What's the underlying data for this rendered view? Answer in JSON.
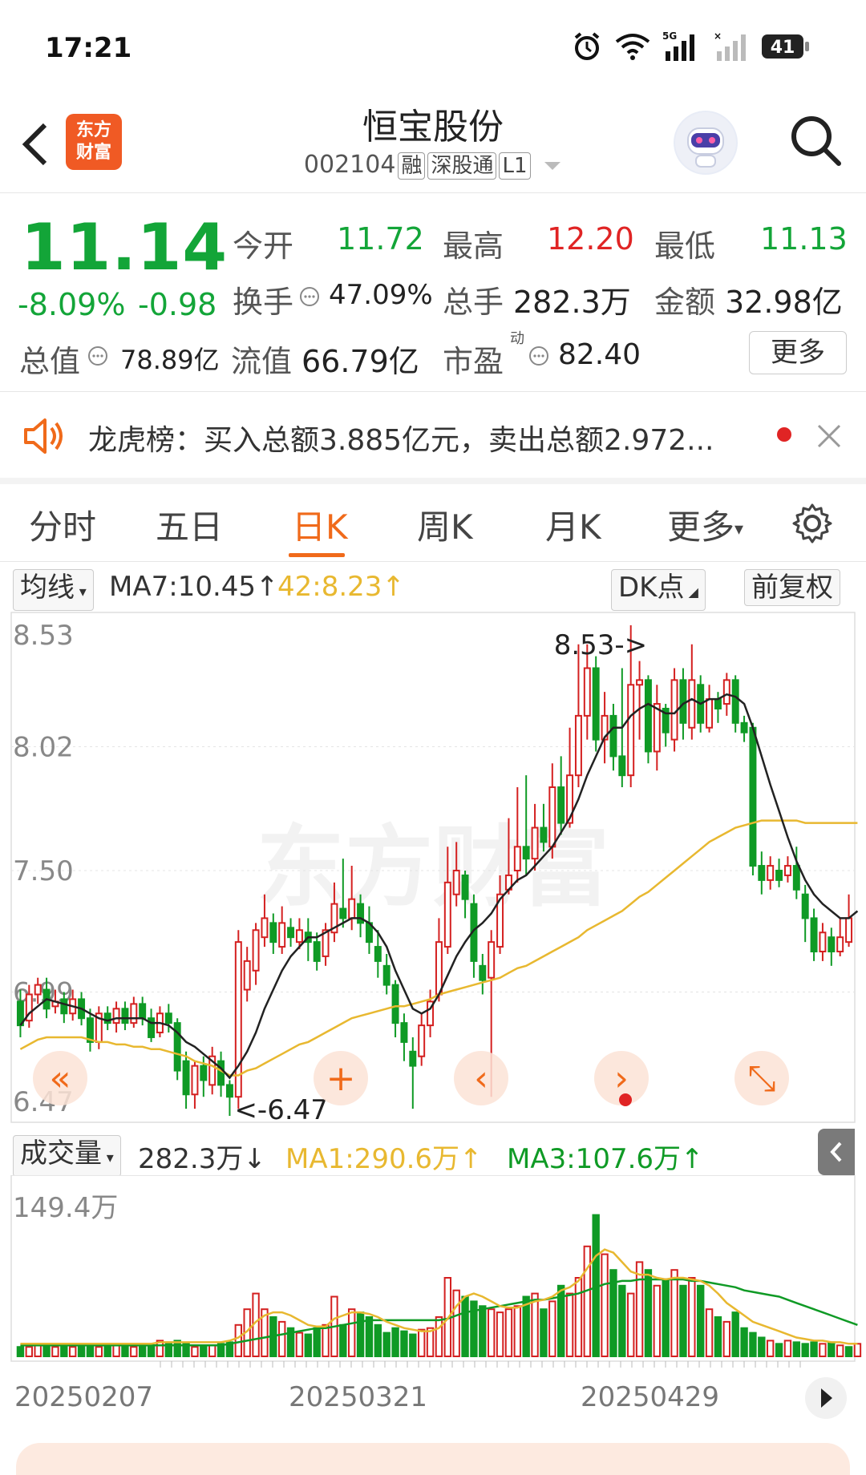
{
  "status": {
    "time": "17:21",
    "battery": "41",
    "network": "5G"
  },
  "header": {
    "logo_line1": "东方",
    "logo_line2": "财富",
    "title": "恒宝股份",
    "code": "002104",
    "tags": [
      "融",
      "深股通",
      "L1"
    ]
  },
  "quote": {
    "price": "11.14",
    "change_pct": "-8.09%",
    "change": "-0.98",
    "open_label": "今开",
    "open": "11.72",
    "high_label": "最高",
    "high": "12.20",
    "low_label": "最低",
    "low": "11.13",
    "turnover_label": "换手",
    "turnover": "47.09%",
    "volume_label": "总手",
    "volume": "282.3万",
    "amount_label": "金额",
    "amount": "32.98亿",
    "total_cap_label": "总值",
    "total_cap": "78.89亿",
    "float_cap_label": "流值",
    "float_cap": "66.79亿",
    "pe_label": "市盈",
    "pe_sup": "动",
    "pe": "82.40",
    "more": "更多"
  },
  "notice": {
    "text": "龙虎榜：买入总额3.885亿元，卖出总额2.972..."
  },
  "tabs": [
    "分时",
    "五日",
    "日K",
    "周K",
    "月K",
    "更多"
  ],
  "active_tab": "日K",
  "chart_toolbar": {
    "indicator": "均线",
    "ma7": "MA7:10.45↑",
    "ma42": "42:8.23↑",
    "dk": "DK点",
    "adjust": "前复权"
  },
  "volume_toolbar": {
    "indicator": "成交量",
    "vol": "282.3万↓",
    "ma1": "MA1:290.6万↑",
    "ma3": "MA3:107.6万↑"
  },
  "colors": {
    "up": "#d42020",
    "down": "#0f9a25",
    "accent": "#f06a1a",
    "ma_short": "#222222",
    "ma_long": "#e8b830"
  },
  "chart_data": {
    "type": "candlestick",
    "y_ticks": [
      "8.53",
      "8.02",
      "7.50",
      "6.99",
      "6.47"
    ],
    "ylim": [
      6.47,
      8.53
    ],
    "max_label": "8.53->",
    "min_label": "<-6.47",
    "x_labels": [
      "20250207",
      "20250321",
      "20250429"
    ],
    "vol_max_label": "149.4万",
    "watermark": "东方财富",
    "candles": [
      [
        6.95,
        6.85,
        7.0,
        6.8
      ],
      [
        6.87,
        6.98,
        7.02,
        6.84
      ],
      [
        6.98,
        7.02,
        7.05,
        6.94
      ],
      [
        7.0,
        6.92,
        7.05,
        6.88
      ],
      [
        6.93,
        6.95,
        7.0,
        6.9
      ],
      [
        6.96,
        6.9,
        6.99,
        6.86
      ],
      [
        6.9,
        6.96,
        7.0,
        6.87
      ],
      [
        6.96,
        6.88,
        6.99,
        6.85
      ],
      [
        6.88,
        6.78,
        6.92,
        6.74
      ],
      [
        6.78,
        6.9,
        6.93,
        6.75
      ],
      [
        6.9,
        6.86,
        6.93,
        6.83
      ],
      [
        6.86,
        6.92,
        6.95,
        6.82
      ],
      [
        6.92,
        6.86,
        6.95,
        6.83
      ],
      [
        6.86,
        6.94,
        6.97,
        6.84
      ],
      [
        6.94,
        6.88,
        6.97,
        6.85
      ],
      [
        6.88,
        6.8,
        6.92,
        6.78
      ],
      [
        6.82,
        6.9,
        6.93,
        6.8
      ],
      [
        6.9,
        6.86,
        6.94,
        6.82
      ],
      [
        6.86,
        6.66,
        6.88,
        6.62
      ],
      [
        6.7,
        6.56,
        6.74,
        6.5
      ],
      [
        6.56,
        6.68,
        6.7,
        6.5
      ],
      [
        6.68,
        6.62,
        6.72,
        6.55
      ],
      [
        6.6,
        6.72,
        6.76,
        6.56
      ],
      [
        6.7,
        6.6,
        6.74,
        6.55
      ],
      [
        6.6,
        6.55,
        6.62,
        6.47
      ],
      [
        6.55,
        7.2,
        7.25,
        6.5
      ],
      [
        7.0,
        7.12,
        7.18,
        6.95
      ],
      [
        7.08,
        7.25,
        7.28,
        7.02
      ],
      [
        7.22,
        7.3,
        7.4,
        7.18
      ],
      [
        7.28,
        7.2,
        7.32,
        7.15
      ],
      [
        7.18,
        7.28,
        7.35,
        7.15
      ],
      [
        7.26,
        7.22,
        7.3,
        7.18
      ],
      [
        7.2,
        7.25,
        7.3,
        7.17
      ],
      [
        7.24,
        7.2,
        7.3,
        7.12
      ],
      [
        7.2,
        7.12,
        7.24,
        7.08
      ],
      [
        7.14,
        7.25,
        7.28,
        7.1
      ],
      [
        7.24,
        7.36,
        7.45,
        7.2
      ],
      [
        7.34,
        7.3,
        7.55,
        7.26
      ],
      [
        7.3,
        7.38,
        7.52,
        7.25
      ],
      [
        7.36,
        7.28,
        7.4,
        7.22
      ],
      [
        7.28,
        7.2,
        7.35,
        7.15
      ],
      [
        7.18,
        7.12,
        7.25,
        7.05
      ],
      [
        7.1,
        7.02,
        7.15,
        6.98
      ],
      [
        7.02,
        6.86,
        7.04,
        6.8
      ],
      [
        6.86,
        6.78,
        6.9,
        6.7
      ],
      [
        6.74,
        6.68,
        6.8,
        6.5
      ],
      [
        6.72,
        6.85,
        6.9,
        6.68
      ],
      [
        6.85,
        6.95,
        7.0,
        6.8
      ],
      [
        6.98,
        7.2,
        7.3,
        6.95
      ],
      [
        7.18,
        7.45,
        7.6,
        7.15
      ],
      [
        7.4,
        7.5,
        7.62,
        7.35
      ],
      [
        7.48,
        7.38,
        7.5,
        7.3
      ],
      [
        7.36,
        7.12,
        7.4,
        7.05
      ],
      [
        7.1,
        7.04,
        7.15,
        6.98
      ],
      [
        7.05,
        7.2,
        7.25,
        6.55
      ],
      [
        7.18,
        7.4,
        7.48,
        7.15
      ],
      [
        7.42,
        7.48,
        7.72,
        7.4
      ],
      [
        7.5,
        7.6,
        7.85,
        7.45
      ],
      [
        7.6,
        7.55,
        7.9,
        7.48
      ],
      [
        7.55,
        7.68,
        7.78,
        7.5
      ],
      [
        7.68,
        7.62,
        7.78,
        7.58
      ],
      [
        7.6,
        7.85,
        7.95,
        7.55
      ],
      [
        7.85,
        7.7,
        7.98,
        7.65
      ],
      [
        7.7,
        7.9,
        8.1,
        7.68
      ],
      [
        7.9,
        8.15,
        8.45,
        7.85
      ],
      [
        8.15,
        8.35,
        8.45,
        8.05
      ],
      [
        8.35,
        8.05,
        8.4,
        8.0
      ],
      [
        8.05,
        8.15,
        8.25,
        7.95
      ],
      [
        8.15,
        7.98,
        8.2,
        7.92
      ],
      [
        7.98,
        7.9,
        8.35,
        7.85
      ],
      [
        7.9,
        8.28,
        8.53,
        7.85
      ],
      [
        8.28,
        8.3,
        8.38,
        8.05
      ],
      [
        8.3,
        8.0,
        8.32,
        7.95
      ],
      [
        8.0,
        8.2,
        8.28,
        7.92
      ],
      [
        8.18,
        8.08,
        8.2,
        8.02
      ],
      [
        8.05,
        8.3,
        8.35,
        8.0
      ],
      [
        8.3,
        8.12,
        8.35,
        8.05
      ],
      [
        8.1,
        8.3,
        8.45,
        8.05
      ],
      [
        8.28,
        8.12,
        8.32,
        8.08
      ],
      [
        8.1,
        8.22,
        8.28,
        8.08
      ],
      [
        8.22,
        8.18,
        8.25,
        8.12
      ],
      [
        8.2,
        8.3,
        8.33,
        8.15
      ],
      [
        8.3,
        8.12,
        8.32,
        8.08
      ],
      [
        8.12,
        8.08,
        8.15,
        8.04
      ],
      [
        8.1,
        7.52,
        8.12,
        7.48
      ],
      [
        7.52,
        7.46,
        7.58,
        7.4
      ],
      [
        7.46,
        7.52,
        7.56,
        7.42
      ],
      [
        7.5,
        7.46,
        7.55,
        7.43
      ],
      [
        7.48,
        7.52,
        7.56,
        7.45
      ],
      [
        7.52,
        7.42,
        7.6,
        7.38
      ],
      [
        7.4,
        7.3,
        7.44,
        7.2
      ],
      [
        7.3,
        7.16,
        7.34,
        7.12
      ],
      [
        7.16,
        7.24,
        7.28,
        7.12
      ],
      [
        7.22,
        7.16,
        7.26,
        7.1
      ],
      [
        7.16,
        7.22,
        7.3,
        7.14
      ],
      [
        7.2,
        7.3,
        7.4,
        7.18
      ]
    ],
    "ma_short": [
      6.85,
      6.9,
      6.93,
      6.96,
      6.95,
      6.94,
      6.93,
      6.92,
      6.9,
      6.88,
      6.87,
      6.88,
      6.88,
      6.88,
      6.88,
      6.86,
      6.86,
      6.85,
      6.82,
      6.78,
      6.76,
      6.73,
      6.7,
      6.67,
      6.63,
      6.68,
      6.74,
      6.82,
      6.92,
      7.0,
      7.08,
      7.14,
      7.18,
      7.22,
      7.22,
      7.24,
      7.26,
      7.28,
      7.3,
      7.3,
      7.28,
      7.24,
      7.18,
      7.08,
      7.0,
      6.92,
      6.9,
      6.92,
      6.98,
      7.06,
      7.14,
      7.2,
      7.25,
      7.28,
      7.32,
      7.38,
      7.42,
      7.46,
      7.48,
      7.52,
      7.56,
      7.6,
      7.66,
      7.72,
      7.8,
      7.9,
      7.98,
      8.06,
      8.1,
      8.1,
      8.15,
      8.18,
      8.2,
      8.18,
      8.16,
      8.16,
      8.2,
      8.22,
      8.2,
      8.22,
      8.22,
      8.24,
      8.23,
      8.2,
      8.1,
      7.98,
      7.86,
      7.75,
      7.64,
      7.54,
      7.46,
      7.4,
      7.36,
      7.33,
      7.3,
      7.3,
      7.33
    ],
    "ma_long": [
      6.75,
      6.77,
      6.79,
      6.8,
      6.8,
      6.8,
      6.8,
      6.8,
      6.79,
      6.78,
      6.78,
      6.77,
      6.77,
      6.76,
      6.76,
      6.75,
      6.75,
      6.74,
      6.73,
      6.72,
      6.7,
      6.69,
      6.68,
      6.66,
      6.64,
      6.64,
      6.66,
      6.67,
      6.69,
      6.71,
      6.73,
      6.75,
      6.77,
      6.78,
      6.8,
      6.82,
      6.84,
      6.86,
      6.88,
      6.89,
      6.9,
      6.91,
      6.92,
      6.93,
      6.93,
      6.94,
      6.95,
      6.96,
      6.98,
      6.99,
      7.0,
      7.01,
      7.02,
      7.03,
      7.04,
      7.05,
      7.07,
      7.09,
      7.1,
      7.12,
      7.14,
      7.16,
      7.18,
      7.2,
      7.22,
      7.25,
      7.27,
      7.29,
      7.31,
      7.33,
      7.36,
      7.39,
      7.41,
      7.44,
      7.47,
      7.5,
      7.53,
      7.56,
      7.59,
      7.62,
      7.64,
      7.66,
      7.68,
      7.69,
      7.7,
      7.71,
      7.71,
      7.71,
      7.71,
      7.71,
      7.7,
      7.7,
      7.7,
      7.7,
      7.7,
      7.7,
      7.7
    ],
    "volume": [
      6,
      6,
      7,
      6,
      6,
      6,
      6,
      7,
      6,
      6,
      7,
      7,
      6,
      6,
      6,
      7,
      10,
      9,
      10,
      8,
      6,
      7,
      7,
      8,
      9,
      20,
      30,
      40,
      30,
      25,
      22,
      18,
      15,
      14,
      18,
      20,
      38,
      20,
      30,
      28,
      25,
      20,
      15,
      18,
      16,
      14,
      17,
      18,
      25,
      50,
      42,
      38,
      35,
      32,
      30,
      28,
      30,
      32,
      38,
      40,
      30,
      35,
      45,
      40,
      50,
      70,
      90,
      65,
      55,
      45,
      40,
      60,
      55,
      45,
      48,
      55,
      45,
      50,
      45,
      30,
      25,
      22,
      28,
      18,
      15,
      12,
      10,
      8,
      10,
      9,
      8,
      9,
      8,
      9,
      7,
      6,
      8
    ],
    "vol_up": [
      0,
      1,
      1,
      0,
      1,
      0,
      1,
      0,
      0,
      1,
      0,
      1,
      0,
      1,
      0,
      0,
      1,
      0,
      0,
      0,
      1,
      0,
      1,
      0,
      0,
      1,
      1,
      1,
      1,
      0,
      1,
      0,
      1,
      0,
      0,
      1,
      1,
      0,
      1,
      0,
      0,
      0,
      0,
      0,
      0,
      0,
      1,
      1,
      1,
      1,
      1,
      0,
      0,
      0,
      1,
      1,
      1,
      1,
      0,
      1,
      0,
      1,
      0,
      1,
      1,
      1,
      0,
      1,
      0,
      0,
      1,
      1,
      0,
      1,
      0,
      1,
      0,
      1,
      0,
      1,
      0,
      1,
      0,
      0,
      0,
      0,
      1,
      0,
      1,
      0,
      0,
      0,
      1,
      0,
      1,
      0,
      1
    ],
    "vol_ma1": [
      8,
      8,
      8,
      8,
      8,
      8,
      8,
      8,
      8,
      8,
      8,
      8,
      8,
      8,
      8,
      8,
      9,
      9,
      9,
      9,
      9,
      9,
      9,
      9,
      10,
      12,
      16,
      22,
      26,
      28,
      28,
      26,
      23,
      20,
      19,
      19,
      24,
      26,
      28,
      28,
      27,
      25,
      22,
      20,
      18,
      17,
      16,
      16,
      18,
      24,
      32,
      38,
      40,
      38,
      35,
      32,
      31,
      31,
      33,
      35,
      36,
      38,
      42,
      44,
      48,
      56,
      64,
      68,
      66,
      60,
      54,
      52,
      52,
      50,
      49,
      50,
      50,
      49,
      48,
      45,
      40,
      34,
      30,
      26,
      22,
      20,
      18,
      16,
      14,
      12,
      11,
      10,
      10,
      9,
      9,
      8,
      8
    ],
    "vol_ma3": [
      7,
      7,
      7,
      7,
      7,
      7,
      7,
      7,
      7,
      7,
      7,
      7,
      7,
      7,
      7,
      7,
      7,
      7,
      7,
      7,
      7,
      7,
      7,
      7,
      8,
      9,
      10,
      11,
      12,
      13,
      14,
      15,
      16,
      17,
      18,
      18,
      19,
      20,
      21,
      22,
      23,
      23,
      23,
      23,
      23,
      23,
      23,
      23,
      23,
      24,
      26,
      28,
      29,
      30,
      31,
      32,
      33,
      34,
      35,
      36,
      36,
      37,
      38,
      39,
      40,
      42,
      44,
      46,
      47,
      48,
      48,
      49,
      49,
      49,
      49,
      49,
      49,
      48,
      48,
      47,
      46,
      45,
      44,
      42,
      41,
      40,
      39,
      38,
      36,
      34,
      32,
      30,
      28,
      26,
      24,
      22,
      20
    ]
  }
}
